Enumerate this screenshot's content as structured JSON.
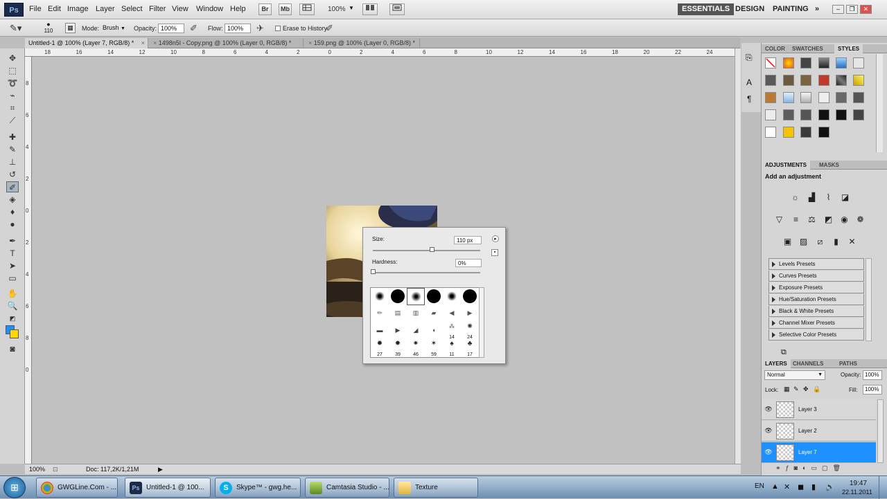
{
  "menu": {
    "logo": "Ps",
    "items": [
      "File",
      "Edit",
      "Image",
      "Layer",
      "Select",
      "Filter",
      "View",
      "Window",
      "Help"
    ],
    "bridge": "Br",
    "minibridge": "Mb",
    "zoom": "100%",
    "workspaces": [
      "ESSENTIALS",
      "DESIGN",
      "PAINTING"
    ],
    "more": "»"
  },
  "options": {
    "brush_size": "110",
    "mode_label": "Mode:",
    "mode_value": "Brush",
    "opacity_label": "Opacity:",
    "opacity_value": "100%",
    "flow_label": "Flow:",
    "flow_value": "100%",
    "erase_history": "Erase to History"
  },
  "doc_tabs": [
    "Untitled-1 @ 100% (Layer 7, RGB/8) *",
    "1498n5l - Copy.png @ 100% (Layer 0, RGB/8) *",
    "159.png @ 100% (Layer 0, RGB/8) *"
  ],
  "ruler_h_labels": [
    "18",
    "16",
    "14",
    "12",
    "10",
    "8",
    "6",
    "4",
    "2",
    "0",
    "2",
    "4",
    "6",
    "8",
    "10",
    "12",
    "14",
    "16",
    "18",
    "20",
    "22",
    "24"
  ],
  "ruler_v_labels": [
    "8",
    "6",
    "4",
    "2",
    "0",
    "2",
    "4",
    "6",
    "8",
    "0"
  ],
  "brush_popup": {
    "size_label": "Size:",
    "size_value": "110 px",
    "size_fraction": 0.55,
    "hardness_label": "Hardness:",
    "hardness_value": "0%",
    "hardness_fraction": 0.0,
    "number_labels": [
      "14",
      "24",
      "27",
      "39",
      "46",
      "59",
      "11",
      "17"
    ]
  },
  "status": {
    "zoom": "100%",
    "doc": "Doc: 117,2K/1,21M"
  },
  "panels": {
    "color_tabs": [
      "COLOR",
      "SWATCHES",
      "STYLES"
    ],
    "adj_tabs": [
      "ADJUSTMENTS",
      "MASKS"
    ],
    "adj_title": "Add an adjustment",
    "presets": [
      "Levels Presets",
      "Curves Presets",
      "Exposure Presets",
      "Hue/Saturation Presets",
      "Black & White Presets",
      "Channel Mixer Presets",
      "Selective Color Presets"
    ],
    "layer_tabs": [
      "LAYERS",
      "CHANNELS",
      "PATHS"
    ],
    "blend_mode": "Normal",
    "opacity_label": "Opacity:",
    "opacity_value": "100%",
    "lock_label": "Lock:",
    "fill_label": "Fill:",
    "fill_value": "100%",
    "layers": [
      "Layer 3",
      "Layer 2",
      "Layer 7"
    ]
  },
  "colors": {
    "foreground": "#1e90ff",
    "background": "#ffd700",
    "selected_layer": "#1e90ff",
    "workspace_active": "#555555"
  },
  "taskbar": {
    "tasks": [
      "GWGLine.Com - ...",
      "Untitled-1 @ 100...",
      "Skype™ - gwg.he...",
      "Camtasia Studio - ...",
      "Texture"
    ],
    "lang": "EN",
    "time": "19:47",
    "date": "22.11.2011"
  }
}
